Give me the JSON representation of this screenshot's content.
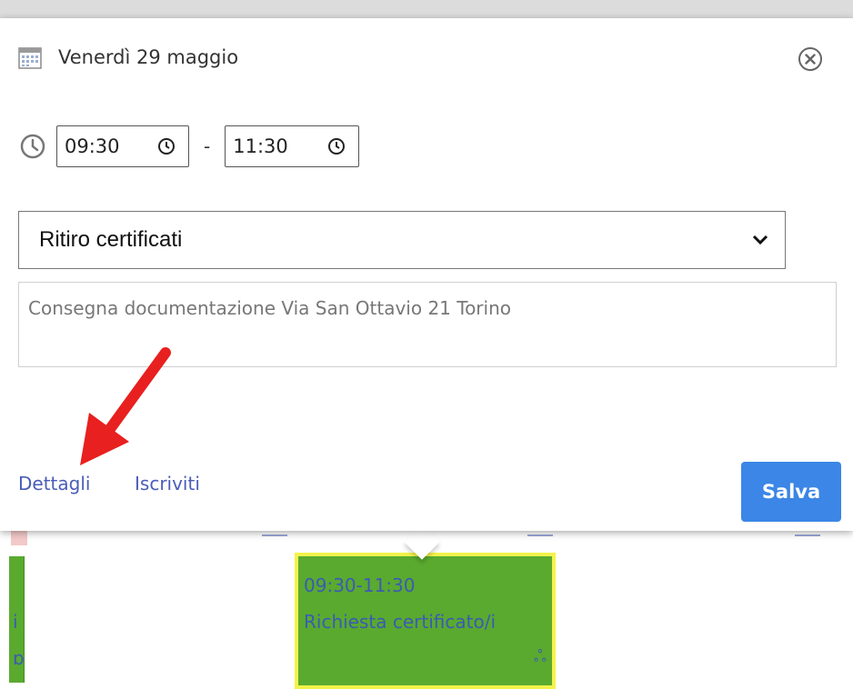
{
  "popup": {
    "date_title": "Venerdì 29 maggio",
    "start_time": "09:30",
    "time_separator": "-",
    "end_time": "11:30",
    "selected_option": "Ritiro certificati",
    "notes": "Consegna documentazione Via San Ottavio 21 Torino",
    "links": {
      "details": "Dettagli",
      "subscribe": "Iscriviti"
    },
    "save_label": "Salva",
    "icons": {
      "calendar": "calendar-icon",
      "clock": "clock-icon",
      "close": "close-icon",
      "chevron": "chevron-down-icon"
    }
  },
  "calendar": {
    "left_event_glyph_1": "i",
    "left_event_glyph_2": "ɒ",
    "event_time": "09:30-11:30",
    "event_title": "Richiesta certificato/i",
    "event_icon": "ஃ"
  },
  "colors": {
    "accent": "#3b86e6",
    "link": "#4a5db8",
    "event_bg": "#5aaa2f",
    "event_border": "#f4f24a",
    "annotation_arrow": "#e8201f"
  }
}
